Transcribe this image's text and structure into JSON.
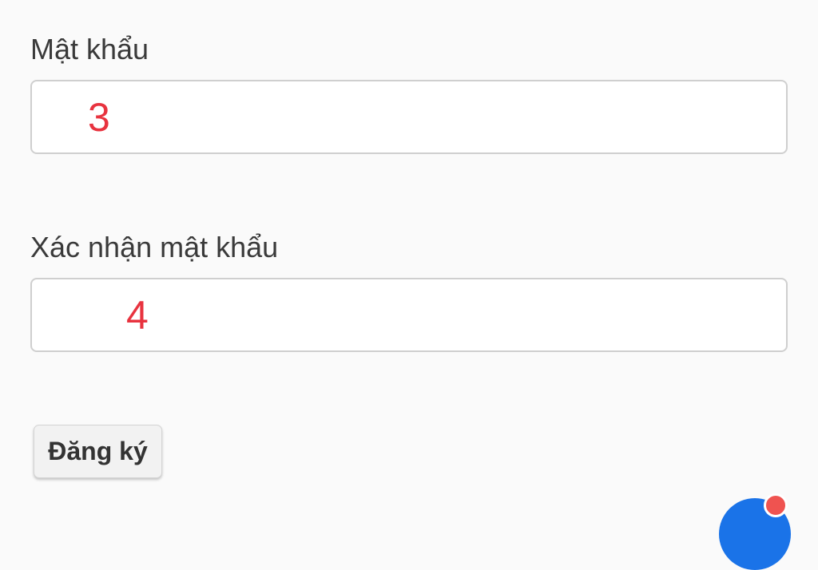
{
  "form": {
    "password": {
      "label": "Mật khẩu",
      "marker": "3"
    },
    "confirm_password": {
      "label": "Xác nhận mật khẩu",
      "marker": "4"
    },
    "submit_label": "Đăng ký"
  },
  "colors": {
    "marker": "#e8333f",
    "input_border": "#cfcfcf",
    "button_bg": "#f2f2f2",
    "corner_widget": "#1a73e8",
    "corner_dot": "#ef5350"
  }
}
